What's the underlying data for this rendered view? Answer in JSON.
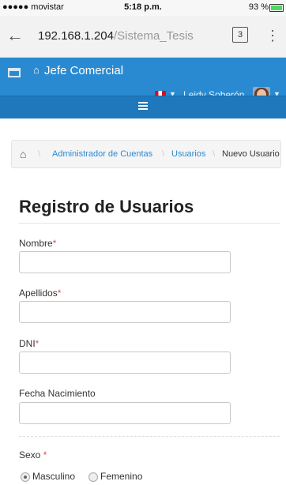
{
  "status_bar": {
    "carrier": "●●●●● movistar",
    "time": "5:18 p.m.",
    "battery": "93 %"
  },
  "browser": {
    "url_host": "192.168.1.204",
    "url_path": "/Sistema_Tesis",
    "tabs_count": "3"
  },
  "header": {
    "role": "Jefe Comercial",
    "user_name": "Leidy Soberón"
  },
  "breadcrumb": {
    "items": [
      "Administrador de Cuentas",
      "Usuarios"
    ],
    "current": "Nuevo Usuario"
  },
  "page": {
    "title": "Registro de Usuarios"
  },
  "form": {
    "nombre_label": "Nombre",
    "apellidos_label": "Apellidos",
    "dni_label": "DNI",
    "fecha_label": "Fecha Nacimiento",
    "sexo_label": "Sexo",
    "required_mark": "*",
    "sexo_options": [
      "Masculino",
      "Femenino"
    ],
    "sexo_selected": "Masculino"
  },
  "colors": {
    "header_bg": "#2a8ad1",
    "nav_bg": "#1f78bb",
    "link": "#2a8ad1",
    "required": "#d9534f"
  }
}
